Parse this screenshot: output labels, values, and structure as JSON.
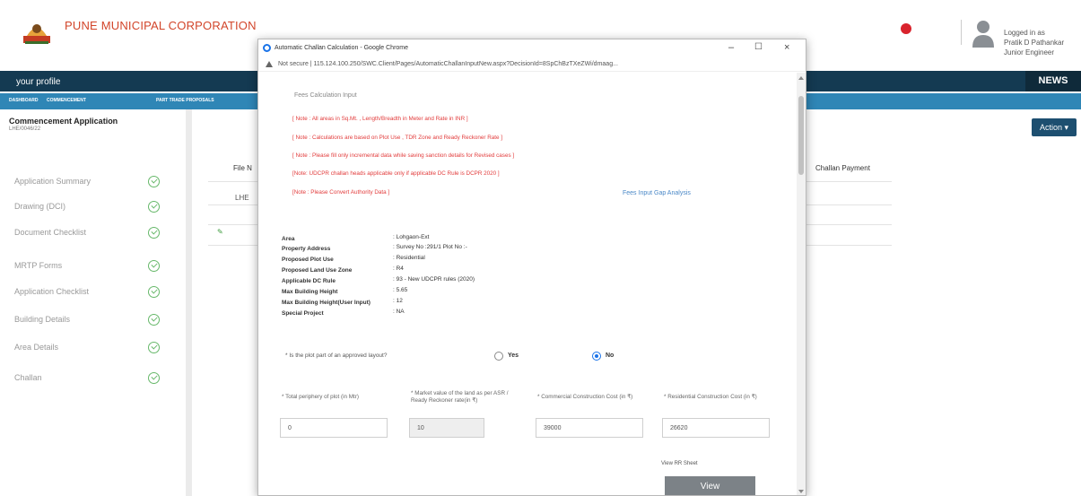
{
  "header": {
    "org_name": "PUNE MUNICIPAL CORPORATION",
    "user_lines": [
      "Logged in as",
      "Pratik D Pathankar",
      "Junior Engineer"
    ]
  },
  "nav": {
    "profile": "your profile",
    "news": "NEWS",
    "tabs": [
      "DASHBOARD",
      "COMMENCEMENT",
      "PART TRADE PROPOSALS"
    ]
  },
  "left_panel": {
    "title": "Commencement Application",
    "subtitle": "LHE/0046/22",
    "items": [
      "Application Summary",
      "Drawing (DCI)",
      "Document Checklist",
      "MRTP Forms",
      "Application Checklist",
      "Building Details",
      "Area Details",
      "Challan"
    ]
  },
  "background_table": {
    "col_file": "File N",
    "col_challan": "Challan Payment",
    "row1": "LHE",
    "action": "Action ▾"
  },
  "popup": {
    "window_title": "Automatic Challan Calculation - Google Chrome",
    "url": "Not secure  |  115.124.100.250/SWC.Client/Pages/AutomaticChallanInputNew.aspx?DecisionId=8SpChBzTXeZWi/dmaag...",
    "section_title": "Fees Calculation Input",
    "notes": [
      "[ Note : All areas in Sq.Mt. , Length/Breadth in Meter and Rate in INR ]",
      "[ Note : Calculations are based on Plot Use , TDR Zone and Ready Reckoner Rate ]",
      "[ Note : Please fill only incremental data while saving sanction details for Revised cases ]",
      "[Note: UDCPR challan heads applicable only if applicable DC Rule is DCPR 2020 ]",
      "[Note : Please Convert Authority Data ]"
    ],
    "gap_link": "Fees Input Gap Analysis",
    "properties": [
      {
        "label": "Area",
        "value": ": Lohgaon-Ext"
      },
      {
        "label": "Property Address",
        "value": ": Survey No :291/1 Plot No :-"
      },
      {
        "label": "Proposed Plot Use",
        "value": ": Residential"
      },
      {
        "label": "Proposed Land Use Zone",
        "value": ": R4"
      },
      {
        "label": "Applicable DC Rule",
        "value": ": 93 - New UDCPR rules (2020)"
      },
      {
        "label": "Max Building Height",
        "value": ": 5.65"
      },
      {
        "label": "Max Building Height(User Input)",
        "value": ": 12"
      },
      {
        "label": "Special Project",
        "value": ": NA"
      }
    ],
    "layout_question": "* Is the plot part of an approved layout?",
    "radio_yes": "Yes",
    "radio_no": "No",
    "fields": [
      {
        "label": "* Total periphery of plot (in Mtr)",
        "value": "0"
      },
      {
        "label": "* Market value of the land as per ASR / Ready Reckoner rate(in ₹)",
        "value": "10"
      },
      {
        "label": "* Commercial Construction Cost (in ₹)",
        "value": "39000"
      },
      {
        "label": "* Residential Construction Cost (in ₹)",
        "value": "26620"
      }
    ],
    "view_rr_sheet": "View RR Sheet",
    "view_button": "View"
  }
}
